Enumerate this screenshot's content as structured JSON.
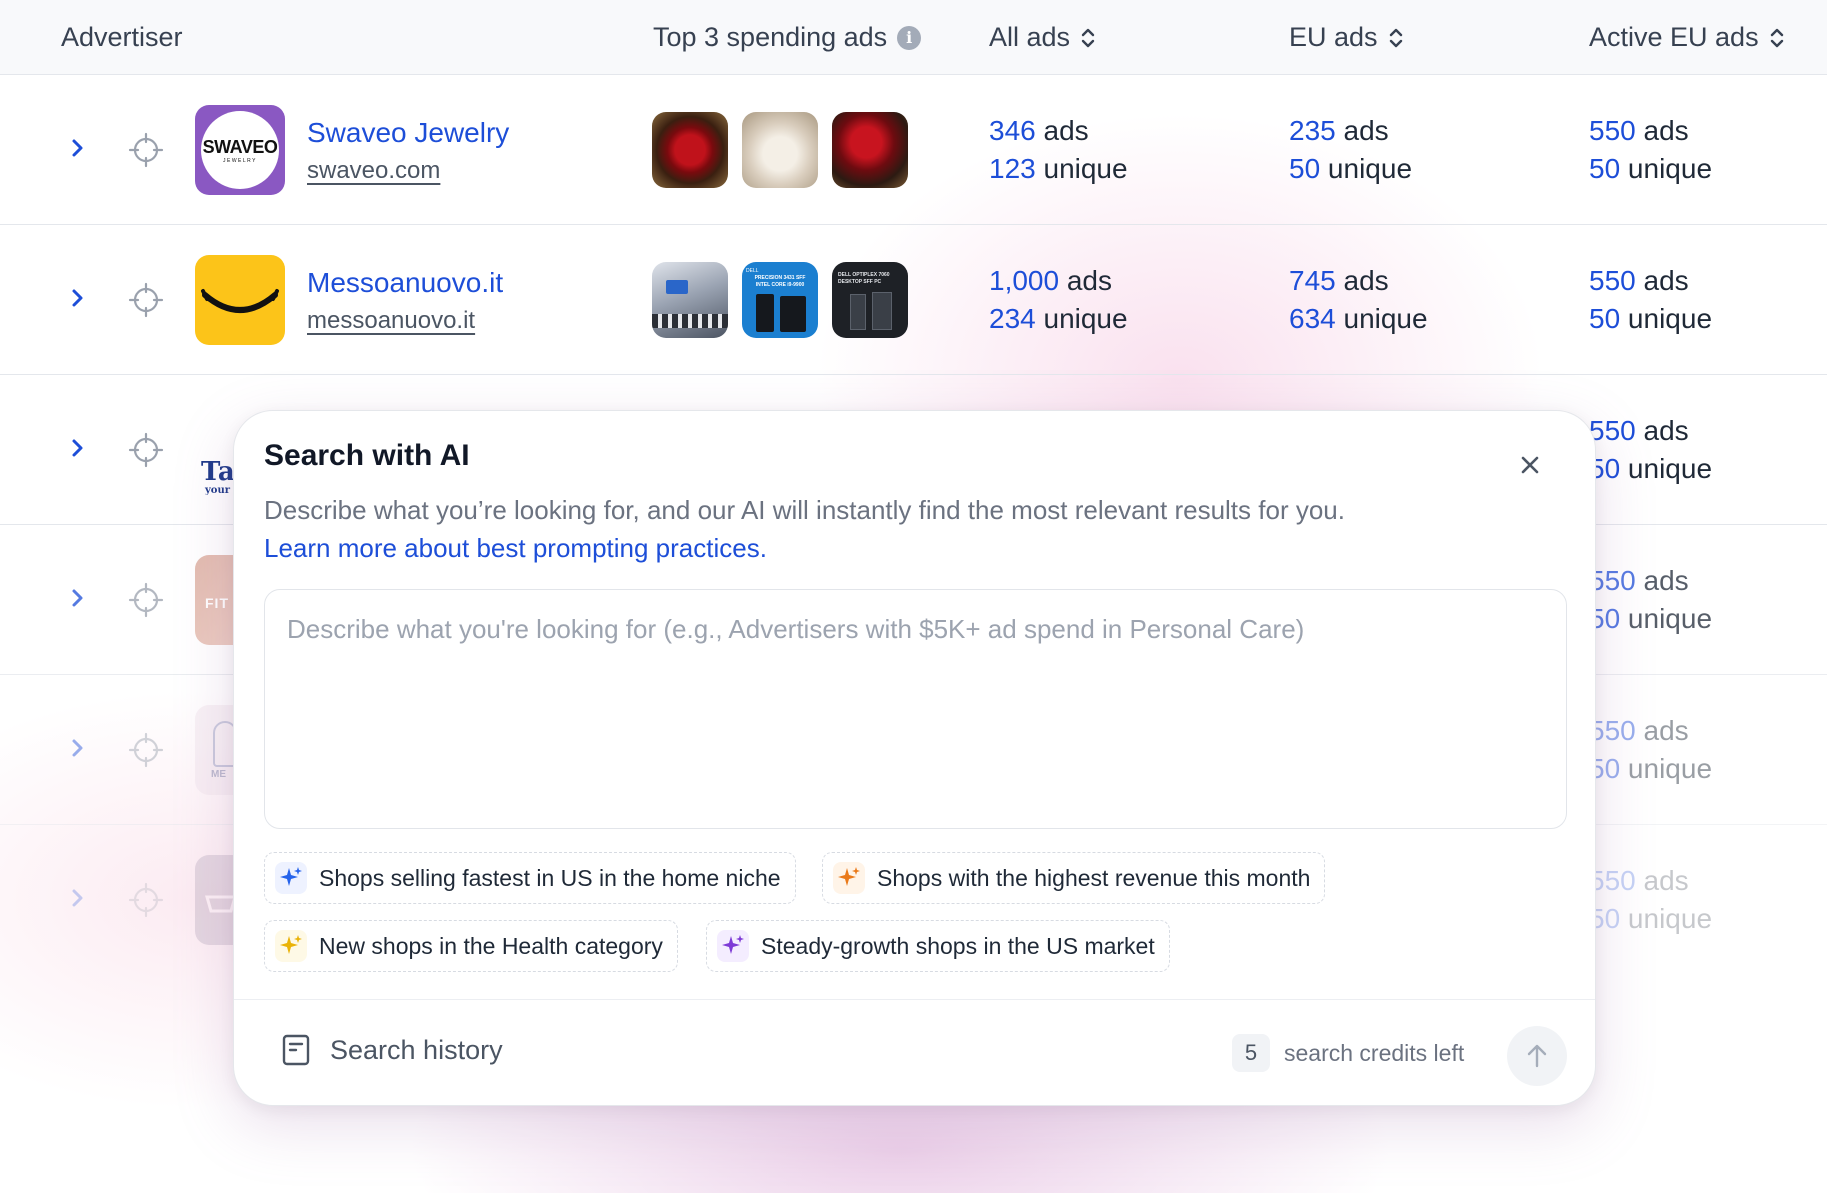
{
  "header": {
    "advertiser": "Advertiser",
    "top3": "Top 3 spending ads",
    "all_ads": "All ads",
    "eu_ads": "EU ads",
    "active_eu_ads": "Active EU ads"
  },
  "rows": [
    {
      "name": "Swaveo Jewelry",
      "url": "swaveo.com",
      "logo_text": "SWAVEO",
      "logo_subtext": "JEWELRY",
      "all_ads": {
        "ads_num": "346",
        "ads_label": " ads",
        "unique_num": "123",
        "unique_label": " unique"
      },
      "eu_ads": {
        "ads_num": "235",
        "ads_label": " ads",
        "unique_num": "50",
        "unique_label": " unique"
      },
      "active_eu_ads": {
        "ads_num": "550",
        "ads_label": " ads",
        "unique_num": "50",
        "unique_label": " unique"
      }
    },
    {
      "name": "Messoanuovo.it",
      "url": "messoanuovo.it",
      "all_ads": {
        "ads_num": "1,000",
        "ads_label": " ads",
        "unique_num": "234",
        "unique_label": " unique"
      },
      "eu_ads": {
        "ads_num": "745",
        "ads_label": " ads",
        "unique_num": "634",
        "unique_label": " unique"
      },
      "active_eu_ads": {
        "ads_num": "550",
        "ads_label": " ads",
        "unique_num": "50",
        "unique_label": " unique"
      }
    },
    {
      "logo_text": "Ta",
      "logo_subtext": "your",
      "active_eu_ads": {
        "ads_num": "550",
        "ads_label": " ads",
        "unique_num": "50",
        "unique_label": " unique"
      }
    },
    {
      "logo_text": "FIT",
      "active_eu_ads": {
        "ads_num": "550",
        "ads_label": " ads",
        "unique_num": "50",
        "unique_label": " unique"
      }
    },
    {
      "logo_text": "ME",
      "active_eu_ads": {
        "ads_num": "550",
        "ads_label": " ads",
        "unique_num": "50",
        "unique_label": " unique"
      }
    },
    {
      "active_eu_ads": {
        "ads_num": "550",
        "ads_label": " ads",
        "unique_num": "50",
        "unique_label": " unique"
      }
    }
  ],
  "thumb_texts": {
    "dell1": "DELL",
    "dell2": "PRECISION 3431 SFF",
    "dell3": "INTEL CORE i9-9900",
    "dell4": "DELL OPTIPLEX 7060",
    "dell5": "DESKTOP SFF PC"
  },
  "modal": {
    "title": "Search with AI",
    "description": "Describe what you’re looking for, and our AI will instantly find the most relevant results for you.",
    "link": "Learn more about best prompting practices.",
    "placeholder": "Describe what you're looking for (e.g., Advertisers with $5K+ ad spend in Personal Care)",
    "chips": [
      {
        "label": "Shops selling fastest in US in the home niche",
        "icon": "sparkle-icon",
        "color": "#2563eb",
        "bg": "#eef2ff"
      },
      {
        "label": "Shops with the highest revenue this month",
        "icon": "sparkle-icon",
        "color": "#ea7a1a",
        "bg": "#fff4e8"
      },
      {
        "label": "New shops in the Health category",
        "icon": "sparkle-icon",
        "color": "#eab308",
        "bg": "#fef9e6"
      },
      {
        "label": "Steady-growth shops in the US market",
        "icon": "sparkle-icon",
        "color": "#7e3bd6",
        "bg": "#f4edff"
      }
    ],
    "history_label": "Search history",
    "credits_num": "5",
    "credits_label": "search credits left"
  },
  "colors": {
    "accent": "#1d4ed8",
    "swaveo_purple": "#8a58c2",
    "messo_yellow": "#fcc419"
  }
}
